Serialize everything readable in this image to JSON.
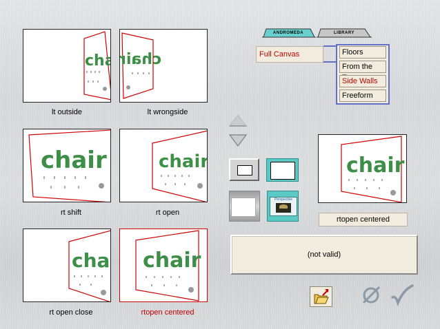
{
  "thumbnails": [
    {
      "id": "lt-outside",
      "label": "lt outside",
      "selected": false
    },
    {
      "id": "lt-wrongside",
      "label": "lt wrongside",
      "selected": false
    },
    {
      "id": "rt-shift",
      "label": "rt shift",
      "selected": false
    },
    {
      "id": "rt-open",
      "label": "rt open",
      "selected": false
    },
    {
      "id": "rt-open-close",
      "label": "rt open close",
      "selected": false
    },
    {
      "id": "rtopen-centered",
      "label": "rtopen centered",
      "selected": true
    }
  ],
  "thumbnail_art_text": "chair",
  "tabs": [
    {
      "label": "ANDROMEDA",
      "active": true
    },
    {
      "label": "LIBRARY",
      "active": false
    }
  ],
  "canvas_field": "Full Canvas",
  "menu": {
    "items": [
      {
        "label": "Floors",
        "active": false
      },
      {
        "label": "From the Top",
        "active": false
      },
      {
        "label": "Side Walls",
        "active": true
      },
      {
        "label": "Freeform",
        "active": false
      }
    ]
  },
  "preview": {
    "caption": "rtopen centered"
  },
  "status": "(not valid)",
  "icons": {
    "up": "arrow-up-icon",
    "down": "arrow-down-icon",
    "frame_plain": "frame-plain-icon",
    "frame_blue": "frame-blue-icon",
    "gradient": "gradient-box-icon",
    "perspective": "perspective-logo-icon",
    "open_folder": "open-folder-icon",
    "cancel": "cancel-icon",
    "accept": "checkmark-icon"
  },
  "perspective_logo_text": "Perspective",
  "colors": {
    "accent_red": "#c00000",
    "menu_border": "#6070c8",
    "teal": "#4fc7c5",
    "art_green": "#2e8b3c"
  }
}
